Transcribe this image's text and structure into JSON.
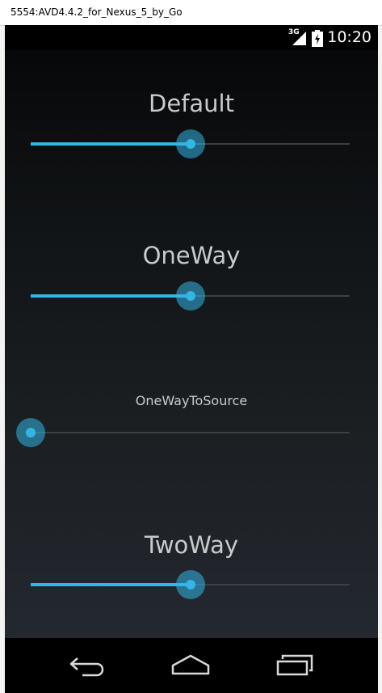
{
  "window": {
    "title": "5554:AVD4.4.2_for_Nexus_5_by_Go"
  },
  "status_bar": {
    "network": "3G",
    "time": "10:20",
    "accent": "#33b5e5"
  },
  "sliders": [
    {
      "label": "Default",
      "value": 0.5
    },
    {
      "label": "OneWay",
      "value": 0.5
    },
    {
      "label": "OneWayToSource",
      "value": 0.0
    },
    {
      "label": "TwoWay",
      "value": 0.5
    }
  ],
  "nav_bar": {
    "back_icon": "back-icon",
    "home_icon": "home-icon",
    "recents_icon": "recents-icon"
  }
}
